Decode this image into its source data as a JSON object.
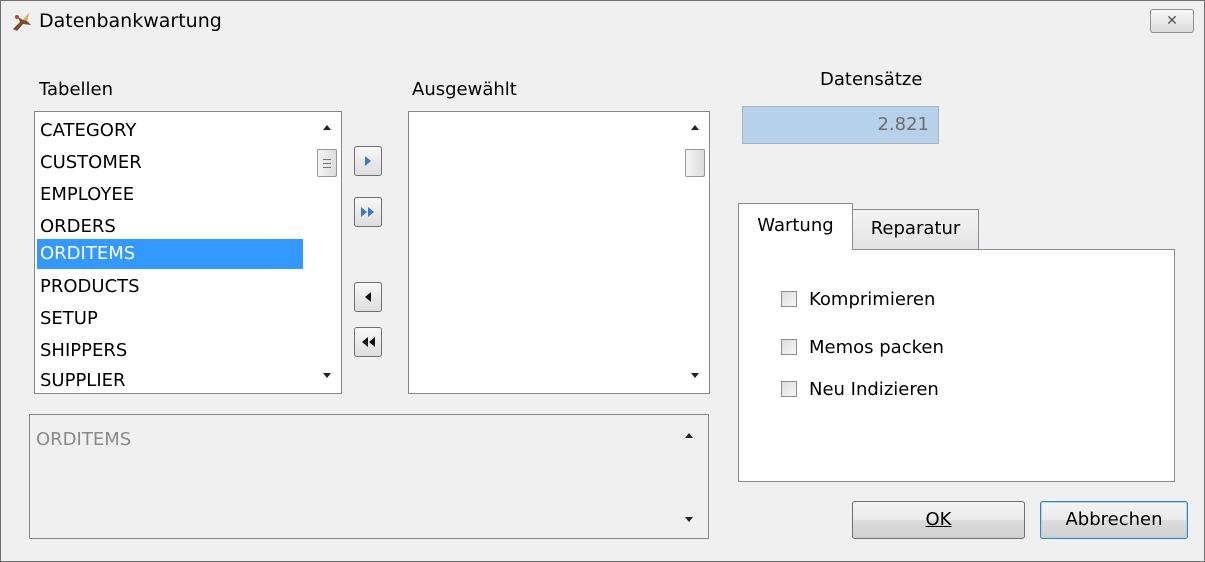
{
  "window": {
    "title": "Datenbankwartung",
    "close_glyph": "✕"
  },
  "tables": {
    "label": "Tabellen",
    "items": [
      "CATEGORY",
      "CUSTOMER",
      "EMPLOYEE",
      "ORDERS",
      "ORDITEMS",
      "PRODUCTS",
      "SETUP",
      "SHIPPERS",
      "SUPPLIER"
    ],
    "selected": "ORDITEMS"
  },
  "selected_list": {
    "label": "Ausgewählt",
    "items": []
  },
  "records": {
    "label": "Datensätze",
    "value": "2.821"
  },
  "move_buttons": {
    "add_one_icon": "arrow-right-icon",
    "add_all_icon": "double-arrow-right-icon",
    "remove_one_icon": "arrow-left-icon",
    "remove_all_icon": "double-arrow-left-icon",
    "accent_color": "#3c78c8"
  },
  "tabs": {
    "items": [
      "Wartung",
      "Reparatur"
    ],
    "active": "Wartung"
  },
  "options": {
    "compress": "Komprimieren",
    "pack_memos": "Memos packen",
    "reindex": "Neu Indizieren"
  },
  "memo": {
    "text": "ORDITEMS"
  },
  "buttons": {
    "ok": "OK",
    "cancel": "Abbrechen"
  }
}
